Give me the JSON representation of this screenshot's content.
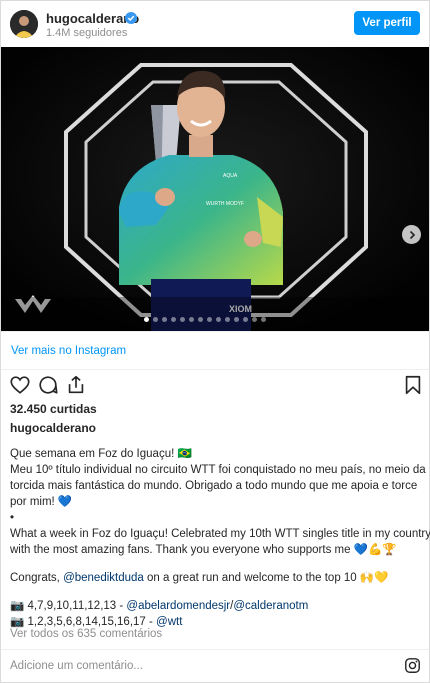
{
  "header": {
    "username": "hugocalderano",
    "followers": "1.4M seguidores",
    "profile_button": "Ver perfil",
    "verified_icon": "verified-badge-icon",
    "accent": "#0095f6"
  },
  "photo": {
    "description_icon": "post-photo",
    "dots_total": 14,
    "dots_active": 1,
    "next_icon": "chevron-right-icon",
    "shirt_text": "WURTH MODYF",
    "shorts_text": "XIOM",
    "chest_logo": "AQUA"
  },
  "see_more": "Ver mais no Instagram",
  "actions": {
    "like_icon": "heart-icon",
    "comment_icon": "comment-icon",
    "share_icon": "share-icon",
    "save_icon": "bookmark-icon"
  },
  "likes": "32.450 curtidas",
  "author": "hugocalderano",
  "caption": {
    "l1": "Que semana em Foz do Iguaçu! 🇧🇷",
    "l2": "Meu 10º título individual no circuito WTT foi conquistado no meu país, no meio da",
    "l3": "torcida mais fantástica do mundo. Obrigado a todo mundo que me apoia e torce",
    "l4": "por mim! 💙",
    "l5": "•",
    "l6": "What a week in Foz do Iguaçu! Celebrated my 10th WTT singles title in my country,",
    "l7": "with the most amazing fans. Thank you everyone who supports me 💙💪🏆",
    "l8a": "Congrats, ",
    "l8b": "@benediktduda",
    "l8c": " on a great run and welcome to the top 10 🙌💛",
    "l9a": "📷 4,7,9,10,11,12,13 - ",
    "l9b": "@abelardomendesjr",
    "l9c": "/",
    "l9d": "@calderanotm",
    "l10a": "📷 1,2,3,5,6,8,14,15,16,17 - ",
    "l10b": "@wtt"
  },
  "view_comments": "Ver todos os 635 comentários",
  "comment_placeholder": "Adicione um comentário...",
  "instagram_icon": "instagram-logo-icon"
}
